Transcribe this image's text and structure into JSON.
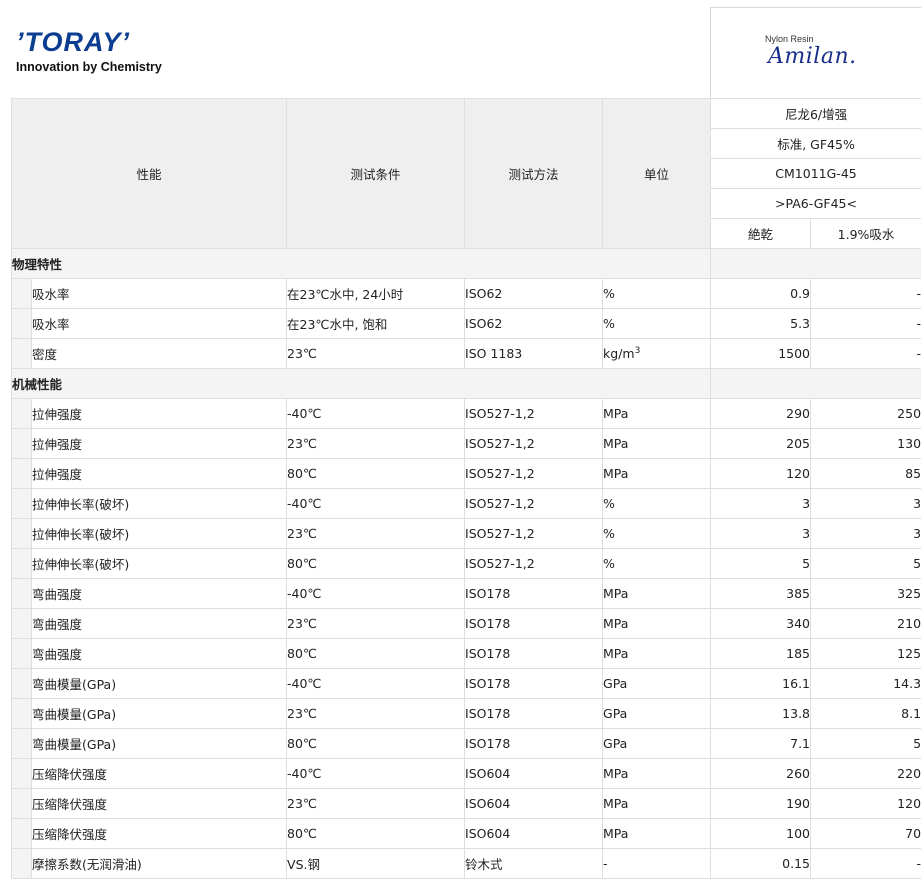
{
  "brand": {
    "logo": "’TORAY’",
    "tagline": "Innovation by Chemistry",
    "product_small": "Nylon Resin",
    "product_logo": "Amilan."
  },
  "columns": {
    "property": "性能",
    "condition": "测试条件",
    "method": "测试方法",
    "unit": "单位",
    "material": "尼龙6/增强",
    "grade_type": "标准, GF45%",
    "grade": "CM1011G-45",
    "code": ">PA6-GF45<",
    "dry": "絶乾",
    "wet": "1.9%吸水"
  },
  "sections": [
    {
      "title": "物理特性",
      "rows": [
        {
          "property": "吸水率",
          "condition": "在23℃水中, 24小时",
          "method": "ISO62",
          "unit": "%",
          "dry": "0.9",
          "wet": "-"
        },
        {
          "property": "吸水率",
          "condition": "在23℃水中, 饱和",
          "method": "ISO62",
          "unit": "%",
          "dry": "5.3",
          "wet": "-"
        },
        {
          "property": "密度",
          "condition": "23℃",
          "method": "ISO 1183",
          "unit": "kg/m",
          "unit_sup": "3",
          "dry": "1500",
          "wet": "-"
        }
      ]
    },
    {
      "title": "机械性能",
      "rows": [
        {
          "property": "拉伸强度",
          "condition": "-40℃",
          "method": "ISO527-1,2",
          "unit": "MPa",
          "dry": "290",
          "wet": "250"
        },
        {
          "property": "拉伸强度",
          "condition": "23℃",
          "method": "ISO527-1,2",
          "unit": "MPa",
          "dry": "205",
          "wet": "130"
        },
        {
          "property": "拉伸强度",
          "condition": "80℃",
          "method": "ISO527-1,2",
          "unit": "MPa",
          "dry": "120",
          "wet": "85"
        },
        {
          "property": "拉伸伸长率(破坏)",
          "condition": "-40℃",
          "method": "ISO527-1,2",
          "unit": "%",
          "dry": "3",
          "wet": "3"
        },
        {
          "property": "拉伸伸长率(破坏)",
          "condition": "23℃",
          "method": "ISO527-1,2",
          "unit": "%",
          "dry": "3",
          "wet": "3"
        },
        {
          "property": "拉伸伸长率(破坏)",
          "condition": "80℃",
          "method": "ISO527-1,2",
          "unit": "%",
          "dry": "5",
          "wet": "5"
        },
        {
          "property": "弯曲强度",
          "condition": "-40℃",
          "method": "ISO178",
          "unit": "MPa",
          "dry": "385",
          "wet": "325"
        },
        {
          "property": "弯曲强度",
          "condition": "23℃",
          "method": "ISO178",
          "unit": "MPa",
          "dry": "340",
          "wet": "210"
        },
        {
          "property": "弯曲强度",
          "condition": "80℃",
          "method": "ISO178",
          "unit": "MPa",
          "dry": "185",
          "wet": "125"
        },
        {
          "property": "弯曲模量(GPa)",
          "condition": "-40℃",
          "method": "ISO178",
          "unit": "GPa",
          "dry": "16.1",
          "wet": "14.3"
        },
        {
          "property": "弯曲模量(GPa)",
          "condition": "23℃",
          "method": "ISO178",
          "unit": "GPa",
          "dry": "13.8",
          "wet": "8.1"
        },
        {
          "property": "弯曲模量(GPa)",
          "condition": "80℃",
          "method": "ISO178",
          "unit": "GPa",
          "dry": "7.1",
          "wet": "5"
        },
        {
          "property": "压缩降伏强度",
          "condition": "-40℃",
          "method": "ISO604",
          "unit": "MPa",
          "dry": "260",
          "wet": "220"
        },
        {
          "property": "压缩降伏强度",
          "condition": "23℃",
          "method": "ISO604",
          "unit": "MPa",
          "dry": "190",
          "wet": "120"
        },
        {
          "property": "压缩降伏强度",
          "condition": "80℃",
          "method": "ISO604",
          "unit": "MPa",
          "dry": "100",
          "wet": "70"
        },
        {
          "property": "摩擦系数(无润滑油)",
          "condition": "VS.钢",
          "method": "铃木式",
          "unit": "-",
          "dry": "0.15",
          "wet": "-"
        }
      ]
    }
  ]
}
